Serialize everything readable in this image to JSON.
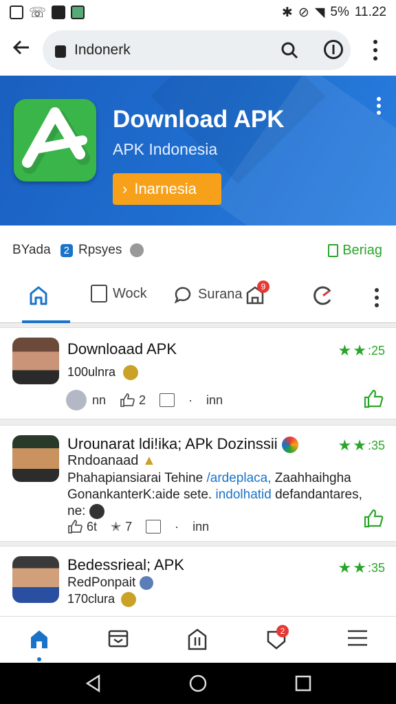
{
  "status_bar": {
    "battery": "5%",
    "time": "11.22"
  },
  "url_bar": {
    "url": "Indonerk"
  },
  "hero": {
    "title": "Download APK",
    "subtitle": "APK Indonesia",
    "button_label": "Inarnesia"
  },
  "info_row": {
    "label": "BYada",
    "count": "2",
    "badge_label": "Rpsyes",
    "action_label": "Beriag"
  },
  "tabs": [
    {
      "label": "Wock"
    },
    {
      "label": "Surana"
    }
  ],
  "tab_badge": "9",
  "cards": [
    {
      "title": "Downloaad APK",
      "rating": ":25",
      "line1": "100ulnra",
      "author": "nn",
      "likes": "2",
      "comments": "inn"
    },
    {
      "title": "Urounarat ldi!ika; APk Dozinssii",
      "rating": ":35",
      "line1": "Rndoanaad",
      "line2a": "Phahapiansiarai Tehine",
      "line2b": "/ardeplaca,",
      "line2c": "Zaahhaihgha",
      "line3a": "GonankanterK:aide sete.",
      "line3b": "indolhatid",
      "line3c": "defandantares,",
      "line4": "ne:",
      "author": "6t",
      "likes": "7",
      "comments": "inn"
    },
    {
      "title": "Bedessrieal; APK",
      "rating": ":35",
      "line1": "RedPonpait",
      "line2": "170clura"
    }
  ],
  "bottom_nav_badge": "2",
  "colors": {
    "accent_blue": "#1a73c8",
    "green": "#2aa52a",
    "orange": "#f7a11a",
    "hero_blue": "#1f6fd0"
  }
}
